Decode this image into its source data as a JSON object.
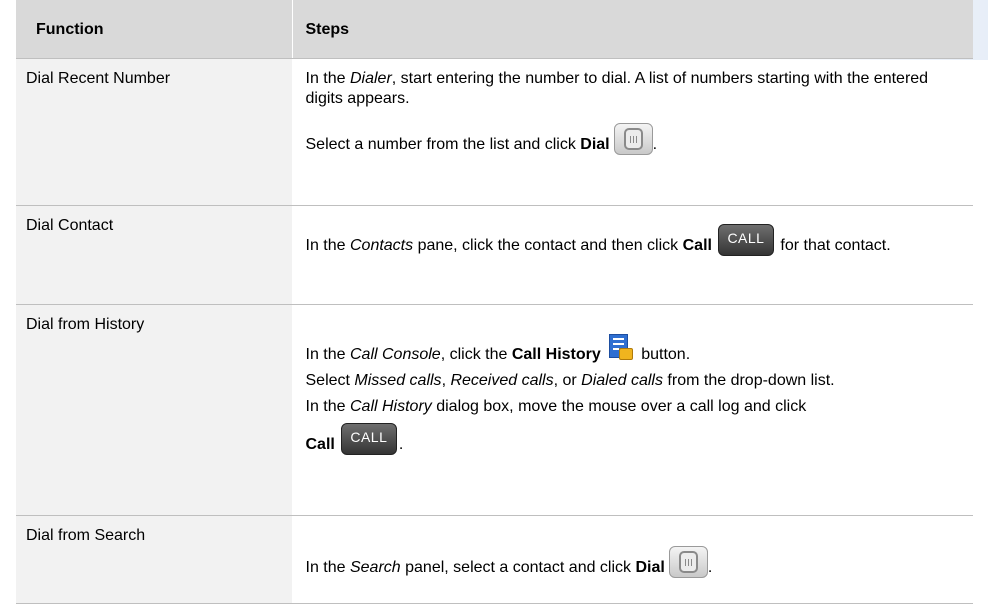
{
  "table": {
    "header": {
      "function": "Function",
      "steps": "Steps"
    },
    "rows": [
      {
        "function": "Dial Recent Number",
        "p1_a": "In the ",
        "p1_b": "Dialer",
        "p1_c": ", start entering the number to dial.  A list of numbers starting with the entered digits appears.",
        "p2_a": "Select a number from the list and click ",
        "p2_b": "Dial",
        "p2_icon": "phone-dial-icon",
        "p2_end": "."
      },
      {
        "function": "Dial Contact",
        "p1_a": "In the ",
        "p1_b": "Contacts",
        "p1_c": " pane, click the contact and then click ",
        "p1_d": "Call",
        "p1_icon_text": "CALL",
        "p1_e": " for that contact."
      },
      {
        "function": "Dial from History",
        "p1_a": "In the ",
        "p1_b": "Call Console",
        "p1_c": ", click the ",
        "p1_d": "Call History",
        "p1_icon": "call-history-icon",
        "p1_e": " button.",
        "p2_a": "Select ",
        "p2_b": "Missed calls",
        "p2_c": ", ",
        "p2_d": "Received calls",
        "p2_e": ", or ",
        "p2_f": "Dialed calls",
        "p2_g": " from the drop-down list.",
        "p3_a": "In the ",
        "p3_b": "Call History",
        "p3_c": " dialog box, move the mouse over a call log and click",
        "p4_a": "Call",
        "p4_icon_text": "CALL",
        "p4_end": "."
      },
      {
        "function": "Dial from Search",
        "p1_a": "In the ",
        "p1_b": "Search",
        "p1_c": " panel, select a contact and click ",
        "p1_d": "Dial",
        "p1_icon": "phone-dial-icon",
        "p1_end": "."
      }
    ]
  }
}
